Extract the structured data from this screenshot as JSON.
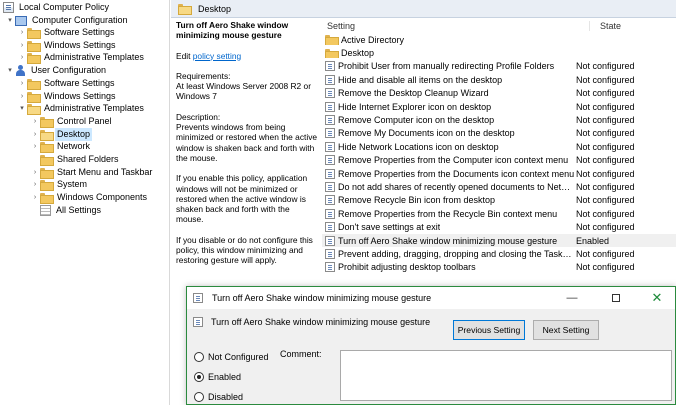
{
  "tree": {
    "root": "Local Computer Policy",
    "computer_config": "Computer Configuration",
    "cc_software": "Software Settings",
    "cc_windows": "Windows Settings",
    "cc_admin": "Administrative Templates",
    "user_config": "User Configuration",
    "uc_software": "Software Settings",
    "uc_windows": "Windows Settings",
    "uc_admin": "Administrative Templates",
    "control_panel": "Control Panel",
    "desktop": "Desktop",
    "network": "Network",
    "shared_folders": "Shared Folders",
    "start_menu": "Start Menu and Taskbar",
    "system": "System",
    "windows_components": "Windows Components",
    "all_settings": "All Settings"
  },
  "path_bar": {
    "label": "Desktop"
  },
  "description": {
    "title": "Turn off Aero Shake window minimizing mouse gesture",
    "edit_prefix": "Edit ",
    "edit_link": "policy setting",
    "requirements_label": "Requirements:",
    "requirements": "At least Windows Server 2008 R2 or Windows 7",
    "description_label": "Description:",
    "description": "Prevents windows from being minimized or restored when the active window is shaken back and forth with the mouse.",
    "enable_text": "If you enable this policy, application windows will not be minimized or restored when the active window is shaken back and forth with the mouse.",
    "disable_text": "If you disable or do not configure this policy, this window minimizing and restoring gesture will apply."
  },
  "settings_table": {
    "col_setting": "Setting",
    "col_state": "State",
    "rows": [
      {
        "name": "Active Directory",
        "state": "",
        "type": "folder"
      },
      {
        "name": "Desktop",
        "state": "",
        "type": "folder"
      },
      {
        "name": "Prohibit User from manually redirecting Profile Folders",
        "state": "Not configured",
        "type": "policy"
      },
      {
        "name": "Hide and disable all items on the desktop",
        "state": "Not configured",
        "type": "policy"
      },
      {
        "name": "Remove the Desktop Cleanup Wizard",
        "state": "Not configured",
        "type": "policy"
      },
      {
        "name": "Hide Internet Explorer icon on desktop",
        "state": "Not configured",
        "type": "policy"
      },
      {
        "name": "Remove Computer icon on the desktop",
        "state": "Not configured",
        "type": "policy"
      },
      {
        "name": "Remove My Documents icon on the desktop",
        "state": "Not configured",
        "type": "policy"
      },
      {
        "name": "Hide Network Locations icon on desktop",
        "state": "Not configured",
        "type": "policy"
      },
      {
        "name": "Remove Properties from the Computer icon context menu",
        "state": "Not configured",
        "type": "policy"
      },
      {
        "name": "Remove Properties from the Documents icon context menu",
        "state": "Not configured",
        "type": "policy"
      },
      {
        "name": "Do not add shares of recently opened documents to Networ...",
        "state": "Not configured",
        "type": "policy"
      },
      {
        "name": "Remove Recycle Bin icon from desktop",
        "state": "Not configured",
        "type": "policy"
      },
      {
        "name": "Remove Properties from the Recycle Bin context menu",
        "state": "Not configured",
        "type": "policy"
      },
      {
        "name": "Don't save settings at exit",
        "state": "Not configured",
        "type": "policy"
      },
      {
        "name": "Turn off Aero Shake window minimizing mouse gesture",
        "state": "Enabled",
        "type": "policy"
      },
      {
        "name": "Prevent adding, dragging, dropping and closing the Taskbar...",
        "state": "Not configured",
        "type": "policy"
      },
      {
        "name": "Prohibit adjusting desktop toolbars",
        "state": "Not configured",
        "type": "policy"
      }
    ]
  },
  "dialog": {
    "title": "Turn off Aero Shake window minimizing mouse gesture",
    "header": "Turn off Aero Shake window minimizing mouse gesture",
    "prev_button": "Previous Setting",
    "next_button": "Next Setting",
    "radio_not_configured": "Not Configured",
    "radio_enabled": "Enabled",
    "radio_disabled": "Disabled",
    "selected_option": "Enabled",
    "comment_label": "Comment:",
    "comment_value": "",
    "minimize_glyph": "—",
    "close_glyph": "✕"
  },
  "colors": {
    "dialog_border": "#2b8a3e",
    "selection": "#cce8ff",
    "link": "#0066cc"
  }
}
